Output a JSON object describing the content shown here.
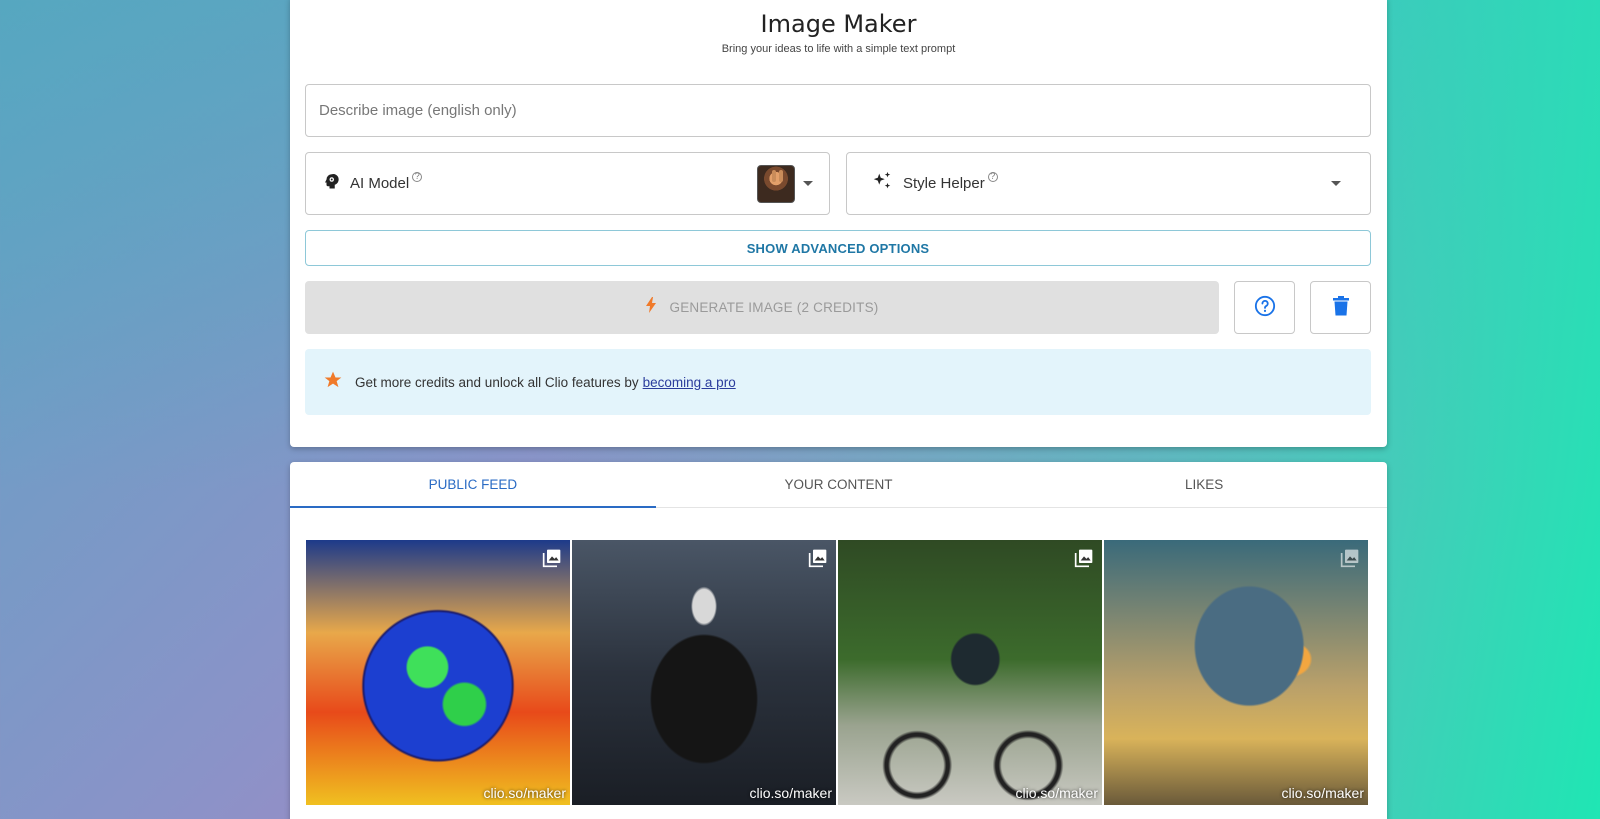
{
  "app": {
    "title": "Image Maker",
    "subtitle": "Bring your ideas to life with a simple text prompt"
  },
  "prompt": {
    "placeholder": "Describe image (english only)",
    "value": ""
  },
  "model_select": {
    "label": "AI Model",
    "icon": "brain-icon",
    "help_icon": "help-icon"
  },
  "style_select": {
    "label": "Style Helper",
    "icon": "sparkle-icon",
    "help_icon": "help-icon"
  },
  "advanced_button": {
    "label": "SHOW ADVANCED OPTIONS"
  },
  "generate_button": {
    "label": "GENERATE IMAGE (2 CREDITS)",
    "icon": "bolt-icon"
  },
  "icon_buttons": {
    "help": "help-circle-icon",
    "delete": "trash-icon"
  },
  "promo": {
    "text": "Get more credits and unlock all Clio features by",
    "link": "becoming a pro",
    "icon": "star-icon"
  },
  "tabs": [
    {
      "label": "PUBLIC FEED",
      "active": true
    },
    {
      "label": "YOUR CONTENT",
      "active": false
    },
    {
      "label": "LIKES",
      "active": false
    }
  ],
  "gallery": [
    {
      "watermark": "clio.so/maker"
    },
    {
      "watermark": "clio.so/maker"
    },
    {
      "watermark": "clio.so/maker"
    },
    {
      "watermark": "clio.so/maker"
    }
  ],
  "colors": {
    "accent": "#2a6bc4",
    "link": "#1f77a5",
    "bolt": "#f07a2a",
    "promo_bg": "#e3f4fb"
  }
}
